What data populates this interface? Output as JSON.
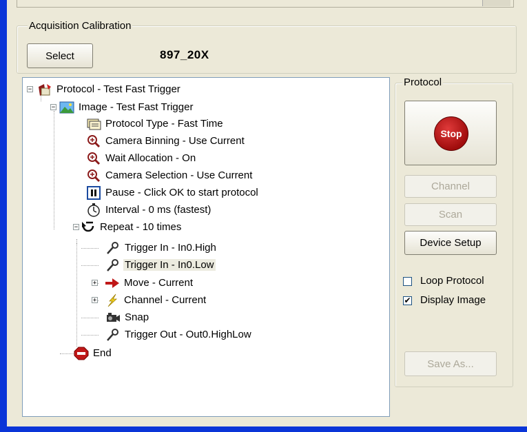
{
  "calibration": {
    "title": "Acquisition Calibration",
    "select_label": "Select",
    "value": "897_20X"
  },
  "tree": {
    "items": [
      {
        "label": "Protocol - Test Fast Trigger",
        "icon": "protocol-icon"
      },
      {
        "label": "Image - Test Fast Trigger",
        "icon": "image-icon"
      },
      {
        "label": "Protocol Type - Fast Time",
        "icon": "protocol-type-icon"
      },
      {
        "label": "Camera Binning - Use Current",
        "icon": "magnifier-icon"
      },
      {
        "label": "Wait Allocation - On",
        "icon": "magnifier-icon"
      },
      {
        "label": "Camera Selection - Use Current",
        "icon": "magnifier-icon"
      },
      {
        "label": "Pause - Click OK to start protocol",
        "icon": "pause-icon"
      },
      {
        "label": "Interval - 0 ms (fastest)",
        "icon": "stopwatch-icon"
      },
      {
        "label": "Repeat - 10 times",
        "icon": "repeat-icon"
      },
      {
        "label": "Trigger In - In0.High",
        "icon": "trigger-icon"
      },
      {
        "label": "Trigger In - In0.Low",
        "icon": "trigger-icon"
      },
      {
        "label": "Move - Current",
        "icon": "move-arrow-icon"
      },
      {
        "label": "Channel - Current",
        "icon": "lightning-icon"
      },
      {
        "label": "Snap",
        "icon": "camera-icon"
      },
      {
        "label": "Trigger Out - Out0.HighLow",
        "icon": "trigger-icon"
      },
      {
        "label": "End",
        "icon": "stop-sign-icon"
      }
    ]
  },
  "protocol_panel": {
    "title": "Protocol",
    "stop_label": "Stop",
    "channel_label": "Channel",
    "scan_label": "Scan",
    "device_setup_label": "Device Setup",
    "loop_protocol_label": "Loop Protocol",
    "loop_protocol_checked": false,
    "display_image_label": "Display Image",
    "display_image_checked": true,
    "save_as_label": "Save As..."
  },
  "colors": {
    "window_frame": "#0a35d8",
    "dialog_bg": "#ece9d8",
    "stop_red": "#b01010"
  }
}
